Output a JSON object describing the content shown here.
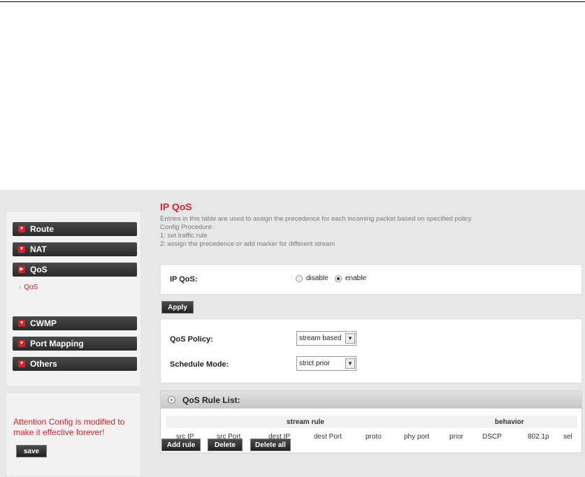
{
  "sidebar": {
    "menu": [
      {
        "label": "Route"
      },
      {
        "label": "NAT"
      },
      {
        "label": "QoS"
      },
      {
        "label": "CWMP"
      },
      {
        "label": "Port Mapping"
      },
      {
        "label": "Others"
      }
    ],
    "active_sub_item": "QoS",
    "attention_text": "Attention Config is modified to make it effective forever!",
    "save_label": "save"
  },
  "main": {
    "title": "IP QoS",
    "description": [
      "Entries in this table are used to assign the precedence for each incoming packet based on specified policy",
      "Config Procedure:",
      "1: set traffic rule",
      "2: assign the precedence or add marker for different stream"
    ],
    "ip_qos": {
      "label": "IP QoS:",
      "options": [
        "disable",
        "enable"
      ],
      "selected": "enable"
    },
    "apply_label": "Apply",
    "qos_policy": {
      "label": "QoS Policy:",
      "value": "stream based"
    },
    "schedule_mode": {
      "label": "Schedule Mode:",
      "value": "strict prior"
    },
    "rule_list": {
      "title": "QoS Rule List:",
      "groups": [
        "stream rule",
        "behavior"
      ],
      "columns": [
        "src IP",
        "src Port",
        "dest IP",
        "dest Port",
        "proto",
        "phy port",
        "prior",
        "DSCP",
        "802.1p",
        "sel"
      ]
    },
    "buttons": {
      "add_rule": "Add rule",
      "delete": "Delete",
      "delete_all": "Delete all"
    }
  },
  "colors": {
    "accent": "#d4232a",
    "button_dark": "#333333",
    "panel_bg": "#e7e7e7"
  },
  "icons": {
    "menu_bullet": "chevron-down-icon",
    "rule_list": "radio-target-icon"
  }
}
